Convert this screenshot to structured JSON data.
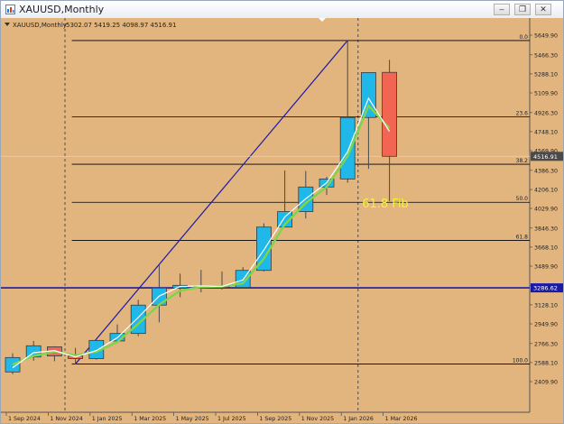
{
  "window": {
    "title": "XAUUSD,Monthly",
    "minimize_glyph": "–",
    "restore_glyph": "❐",
    "close_glyph": "✕"
  },
  "chart_header": {
    "symbol_label": "XAUUSD,Monthly",
    "ohlc": "5302.07 5419.25 4098.97 4516.91"
  },
  "colors": {
    "background": "#e2b47e",
    "bull_body": "#1fb8e8",
    "bear_body": "#f26552",
    "wick": "#4a4a4a",
    "fib_level": "#000000",
    "fib_trend": "#1a1aa8",
    "h_line": "#1a1aa8",
    "ma_fast": "#ffffff",
    "ma_slow": "#7cd64c",
    "current_price_label": "#4a4a4a",
    "h_line_label": "#1a1aa8",
    "annotation": "#f4f43a"
  },
  "chart_data": {
    "type": "candlestick",
    "timeframe": "Monthly",
    "y_axis": {
      "range": [
        2409.9,
        5649.9
      ],
      "ticks": [
        "5649.90",
        "5466.30",
        "5288.10",
        "5109.90",
        "4926.30",
        "4748.10",
        "4569.90",
        "4386.30",
        "4206.10",
        "4029.90",
        "3846.30",
        "3668.10",
        "3489.90",
        "3306.30",
        "3128.10",
        "2949.90",
        "2766.30",
        "2588.10",
        "2409.90"
      ]
    },
    "x_axis": {
      "ticks": [
        {
          "label": "1 Sep 2024",
          "index": 0
        },
        {
          "label": "1 Nov 2024",
          "index": 2
        },
        {
          "label": "1 Jan 2025",
          "index": 4
        },
        {
          "label": "1 Mar 2025",
          "index": 6
        },
        {
          "label": "1 May 2025",
          "index": 8
        },
        {
          "label": "1 Jul 2025",
          "index": 10
        },
        {
          "label": "1 Sep 2025",
          "index": 12
        },
        {
          "label": "1 Nov 2025",
          "index": 14
        },
        {
          "label": "1 Jan 2026",
          "index": 16
        },
        {
          "label": "1 Mar 2026",
          "index": 18
        }
      ]
    },
    "candles": [
      {
        "o": 2500,
        "h": 2675,
        "l": 2480,
        "c": 2635
      },
      {
        "o": 2640,
        "h": 2790,
        "l": 2605,
        "c": 2745
      },
      {
        "o": 2735,
        "h": 2740,
        "l": 2600,
        "c": 2650
      },
      {
        "o": 2650,
        "h": 2725,
        "l": 2570,
        "c": 2625
      },
      {
        "o": 2625,
        "h": 2790,
        "l": 2615,
        "c": 2795
      },
      {
        "o": 2790,
        "h": 2945,
        "l": 2770,
        "c": 2860
      },
      {
        "o": 2860,
        "h": 3175,
        "l": 2835,
        "c": 3125
      },
      {
        "o": 3125,
        "h": 3500,
        "l": 2965,
        "c": 3285
      },
      {
        "o": 3285,
        "h": 3420,
        "l": 3200,
        "c": 3310
      },
      {
        "o": 3305,
        "h": 3455,
        "l": 3245,
        "c": 3300
      },
      {
        "o": 3305,
        "h": 3440,
        "l": 3270,
        "c": 3290
      },
      {
        "o": 3290,
        "h": 3480,
        "l": 3280,
        "c": 3450
      },
      {
        "o": 3450,
        "h": 3890,
        "l": 3440,
        "c": 3855
      },
      {
        "o": 3855,
        "h": 4385,
        "l": 3920,
        "c": 4000
      },
      {
        "o": 4000,
        "h": 4380,
        "l": 3935,
        "c": 4230
      },
      {
        "o": 4230,
        "h": 4325,
        "l": 4155,
        "c": 4305
      },
      {
        "o": 4305,
        "h": 5600,
        "l": 4270,
        "c": 4880
      },
      {
        "o": 4880,
        "h": 5300,
        "l": 4400,
        "c": 5300
      },
      {
        "o": 5302.07,
        "h": 5419.25,
        "l": 4098.97,
        "c": 4516.91
      }
    ],
    "ma_fast": [
      2540,
      2680,
      2700,
      2640,
      2700,
      2820,
      3010,
      3210,
      3300,
      3305,
      3300,
      3360,
      3640,
      3950,
      4120,
      4270,
      4560,
      5060,
      4750
    ],
    "ma_slow": [
      2570,
      2650,
      2690,
      2655,
      2690,
      2780,
      2950,
      3130,
      3260,
      3295,
      3300,
      3330,
      3560,
      3880,
      4080,
      4230,
      4520,
      4990,
      4780
    ],
    "vertical_separators": [
      2,
      16
    ],
    "fibonacci": {
      "anchor_from": {
        "index": 3,
        "price": 2575
      },
      "anchor_to": {
        "index": 16,
        "price": 5600
      },
      "levels": [
        {
          "label": "0.0",
          "price": 5600
        },
        {
          "label": "23.6",
          "price": 4885
        },
        {
          "label": "38.2",
          "price": 4443
        },
        {
          "label": "50.0",
          "price": 4087
        },
        {
          "label": "61.8",
          "price": 3730
        },
        {
          "label": "100.0",
          "price": 2575
        }
      ]
    },
    "horizontal_line": {
      "price": 3286.62,
      "label": "3286.62"
    },
    "current_price": {
      "price": 4516.91,
      "label": "4516.91"
    },
    "annotation": {
      "text": "61.8 Fib",
      "index": 17.8,
      "price": 4040
    }
  }
}
